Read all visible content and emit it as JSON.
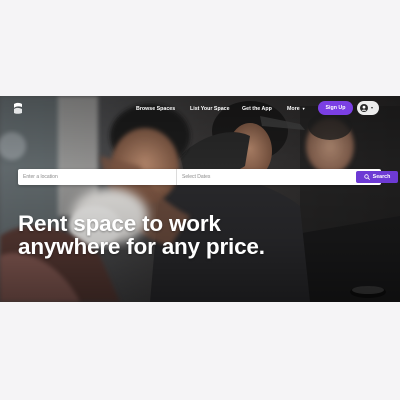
{
  "nav": {
    "links": [
      "Browse Spaces",
      "List Your Space",
      "Get the App"
    ],
    "more_label": "More",
    "more_icon": "chevron-down-icon",
    "signup_label": "Sign Up",
    "account_icon": "user-avatar-icon"
  },
  "search": {
    "location_placeholder": "Enter a location",
    "dates_placeholder": "Select Dates",
    "button_label": "Search",
    "button_icon": "search-icon"
  },
  "hero": {
    "headline": "Rent space to work anywhere for any price."
  },
  "colors": {
    "accent": "#7b3fe4",
    "search_button": "#6d3ad4",
    "page_background": "#f5f4f6"
  }
}
